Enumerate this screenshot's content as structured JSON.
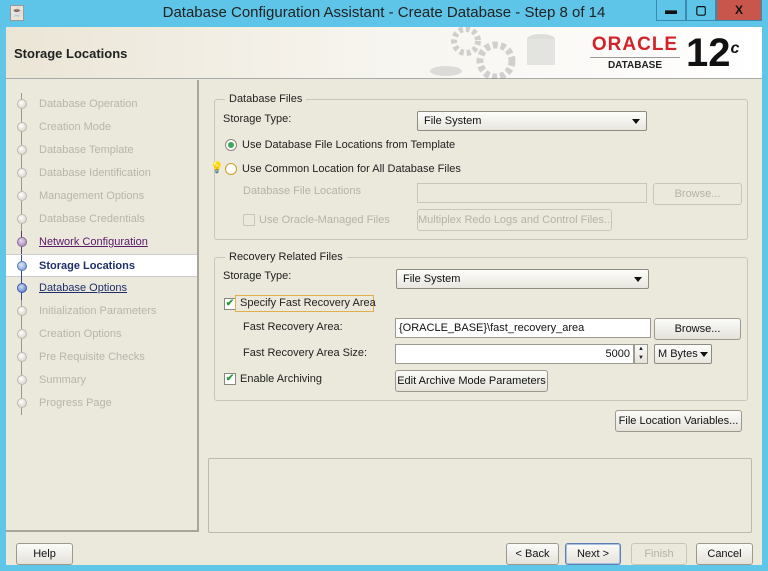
{
  "window": {
    "title": "Database Configuration Assistant - Create Database - Step 8 of 14",
    "app_icon": "java-icon",
    "controls": {
      "minimize": "minimize-icon",
      "maximize": "maximize-icon",
      "close": "close-icon"
    }
  },
  "header": {
    "page_title": "Storage Locations",
    "brand": "ORACLE",
    "brand_sub": "DATABASE",
    "version": "12",
    "version_suffix": "c",
    "brand_color": "#d2232a"
  },
  "sidebar": {
    "steps": [
      {
        "label": "Database Operation",
        "state": "disabled"
      },
      {
        "label": "Creation Mode",
        "state": "disabled"
      },
      {
        "label": "Database Template",
        "state": "disabled"
      },
      {
        "label": "Database Identification",
        "state": "disabled"
      },
      {
        "label": "Management Options",
        "state": "disabled"
      },
      {
        "label": "Database Credentials",
        "state": "disabled"
      },
      {
        "label": "Network Configuration",
        "state": "visited"
      },
      {
        "label": "Storage Locations",
        "state": "current"
      },
      {
        "label": "Database Options",
        "state": "next"
      },
      {
        "label": "Initialization Parameters",
        "state": "disabled"
      },
      {
        "label": "Creation Options",
        "state": "disabled"
      },
      {
        "label": "Pre Requisite Checks",
        "state": "disabled"
      },
      {
        "label": "Summary",
        "state": "disabled"
      },
      {
        "label": "Progress Page",
        "state": "disabled"
      }
    ]
  },
  "database_files": {
    "legend": "Database Files",
    "storage_type_label": "Storage Type:",
    "storage_type_value": "File System",
    "radio_template_label": "Use Database File Locations from Template",
    "radio_template_selected": true,
    "radio_common_label": "Use Common Location for All Database Files",
    "radio_common_selected": false,
    "file_locations_label": "Database File Locations",
    "file_locations_value": "",
    "browse_label": "Browse...",
    "oracle_managed_label": "Use Oracle-Managed Files",
    "oracle_managed_checked": false,
    "multiplex_label": "Multiplex Redo Logs and Control Files..."
  },
  "recovery_files": {
    "legend": "Recovery Related Files",
    "storage_type_label": "Storage Type:",
    "storage_type_value": "File System",
    "specify_fra_label": "Specify Fast Recovery Area",
    "specify_fra_checked": true,
    "fra_label": "Fast Recovery Area:",
    "fra_value": "{ORACLE_BASE}\\fast_recovery_area",
    "browse_label": "Browse...",
    "fra_size_label": "Fast Recovery Area Size:",
    "fra_size_value": "5000",
    "fra_size_unit": "M Bytes",
    "enable_archiving_label": "Enable Archiving",
    "enable_archiving_checked": true,
    "edit_archive_label": "Edit Archive Mode Parameters"
  },
  "file_location_variables_label": "File Location Variables...",
  "footer": {
    "help": "Help",
    "back": "< Back",
    "next": "Next >",
    "finish": "Finish",
    "cancel": "Cancel"
  }
}
